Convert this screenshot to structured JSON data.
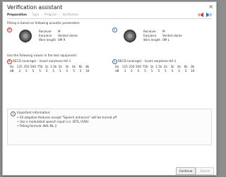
{
  "window": {
    "title": "Verification assistant"
  },
  "steps": [
    "Preparation",
    "Type",
    "Program",
    "Verification"
  ],
  "colors": {
    "right": "#c0392b",
    "left": "#2e6fc0"
  },
  "fitting_note": "Fitting is based on following acoustic parameters",
  "right": {
    "badge": "R",
    "params": [
      {
        "label": "Receiver",
        "value": "M"
      },
      {
        "label": "Earpiece",
        "value": "Vented dome"
      },
      {
        "label": "Wire length",
        "value": "0M R"
      }
    ]
  },
  "left": {
    "badge": "L",
    "params": [
      {
        "label": "Receiver",
        "value": "M"
      },
      {
        "label": "Earpiece",
        "value": "Vented dome"
      },
      {
        "label": "Wire length",
        "value": "0M L"
      }
    ]
  },
  "equipment_note": "Use the following values in the test equipment:",
  "recd_right": {
    "badge": "R",
    "title": "RECD (average) - Insert earphone HA-1",
    "hz_label": "Hz",
    "db_label": "dB",
    "freqs": [
      "125",
      "250",
      "500",
      "750",
      "1k",
      "1.5k",
      "2k",
      "3k",
      "4k",
      "6k",
      "8k"
    ],
    "values": [
      "3",
      "5",
      "5",
      "5",
      "5",
      "5",
      "5",
      "5",
      "5",
      "5",
      "16"
    ]
  },
  "recd_left": {
    "badge": "L",
    "title": "RECD (average) - Insert earphone HA-1",
    "hz_label": "Hz",
    "db_label": "dB",
    "freqs": [
      "125",
      "250",
      "500",
      "750",
      "1k",
      "1.5k",
      "2k",
      "3k",
      "4k",
      "6k",
      "8k"
    ],
    "values": [
      "3",
      "5",
      "5",
      "5",
      "5",
      "5",
      "5",
      "5",
      "5",
      "5",
      "16"
    ]
  },
  "info": {
    "icon": "i",
    "title": "Important information:",
    "items": [
      "• All adaptive features except \"Speech enhancer\" will be turned off",
      "• Use a modulated speech input (i.e. ISTS, ICRA)",
      "• Fitting formula: NAL-NL 2"
    ]
  },
  "buttons": {
    "continue": "Continue",
    "cancel": "Cancel"
  }
}
